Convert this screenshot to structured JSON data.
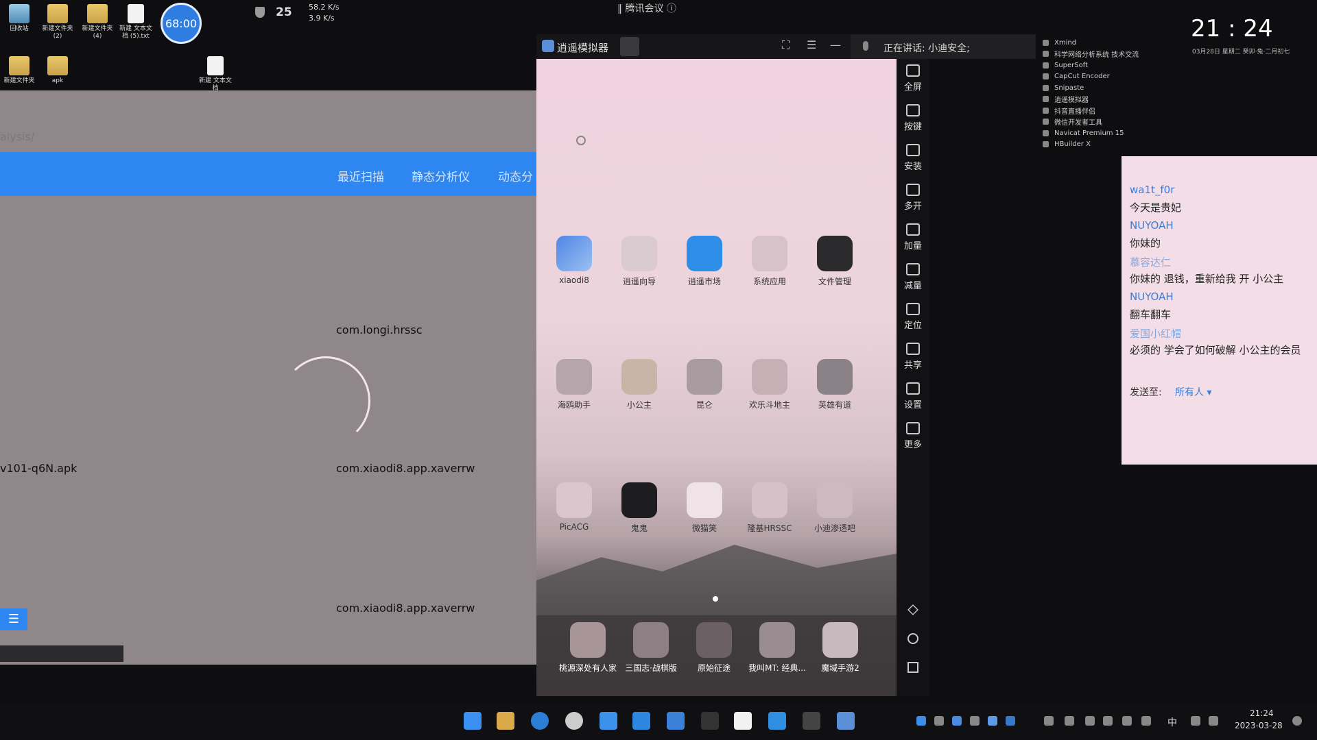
{
  "desktop": {
    "icons": [
      {
        "label": "回收站"
      },
      {
        "label": "新建文件夹 (2)"
      },
      {
        "label": "新建文件夹 (4)"
      },
      {
        "label": "新建 文本文档 (5).txt"
      },
      {
        "label": "新建文件夹"
      },
      {
        "label": "apk"
      },
      {
        "label": "新建 文本文档"
      }
    ],
    "timer": "68:00",
    "temperature": "25",
    "upload_speed": "58.2 K/s",
    "download_speed": "3.9 K/s"
  },
  "meeting": {
    "title": "腾讯会议",
    "speaking": "正在讲话: 小迪安全;"
  },
  "web_app": {
    "address": "alysis/",
    "nav": [
      "最近扫描",
      "静态分析仪",
      "动态分"
    ],
    "packages": [
      "com.longi.hrssc",
      "v101-q6N.apk",
      "com.xiaodi8.app.xaverrw",
      "com.xiaodi8.app.xaverrw"
    ],
    "menu_icon": "list-icon"
  },
  "emulator": {
    "title": "逍遥模拟器",
    "apps_row1": [
      "xiaodi8",
      "逍遥向导",
      "逍遥市场",
      "系统应用",
      "文件管理"
    ],
    "apps_row2": [
      "海鸥助手",
      "小公主",
      "昆仑",
      "欢乐斗地主",
      "英雄有道"
    ],
    "apps_row3": [
      "PicACG",
      "鬼鬼",
      "微猫笑",
      "隆基HRSSC",
      "小迪渗透吧"
    ],
    "dock": [
      "桃源深处有人家",
      "三国志·战棋版",
      "原始征途",
      "我叫MT: 经典...",
      "魔域手游2"
    ],
    "tools": [
      "全屏",
      "按键",
      "安装",
      "多开",
      "加量",
      "减量",
      "定位",
      "共享",
      "设置",
      "更多"
    ]
  },
  "widgets": {
    "apps": [
      "Xmind",
      "科学网络分析系统 技术交流",
      "SuperSoft",
      "CapCut Encoder",
      "Snipaste",
      "逍遥模拟器",
      "抖音直播伴侣",
      "微信开发者工具",
      "Navicat Premium 15",
      "HBuilder X"
    ],
    "clock": "21 : 24",
    "date_line": "03月28日   星期二   癸卯·兔·二月初七"
  },
  "chat": {
    "messages": [
      {
        "name": "wa1t_f0r",
        "text": "今天是贵妃",
        "light": false
      },
      {
        "name": "NUYOAH",
        "text": "你妹的",
        "light": false
      },
      {
        "name": "慕容达仁",
        "text": "你妹的 退钱，重新给我 开 小公主",
        "light": true
      },
      {
        "name": "NUYOAH",
        "text": "翻车翻车",
        "light": false
      },
      {
        "name": "爱国小红帽",
        "text": "必须的 学会了如何破解 小公主的会员",
        "light": true
      }
    ],
    "send_label": "发送至:",
    "send_target": "所有人 ▾"
  },
  "taskbar": {
    "time": "21:24",
    "date": "2023-03-28",
    "ime": "中"
  },
  "colors": {
    "accent": "#2e86f0",
    "chat_bg": "#f3dde6"
  }
}
